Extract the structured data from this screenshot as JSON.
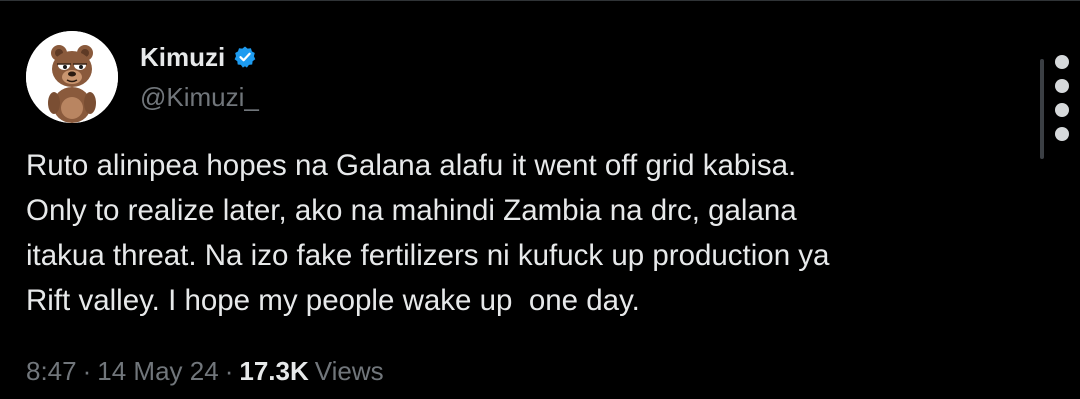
{
  "tweet": {
    "author": {
      "display_name": "Kimuzi",
      "handle": "@Kimuzi_",
      "verified": true,
      "avatar_icon": "cartoon-bear-avatar-icon"
    },
    "text": "Ruto alinipea hopes na Galana alafu it went off grid kabisa.\nOnly to realize later, ako na mahindi Zambia na drc, galana\nitakua threat. Na izo fake fertilizers ni kufuck up production ya\nRift valley. I hope my people wake up  one day.",
    "meta": {
      "time": "8:47",
      "separator": "·",
      "date": "14 May 24",
      "views_count": "17.3K",
      "views_label": "Views"
    }
  },
  "colors": {
    "background": "#000000",
    "primary_text": "#e7e9ea",
    "secondary_text": "#71767b",
    "verified_blue": "#1d9bf0"
  },
  "icons": {
    "more_menu": "more-vertical-icon",
    "verified_badge": "verified-badge-icon"
  }
}
